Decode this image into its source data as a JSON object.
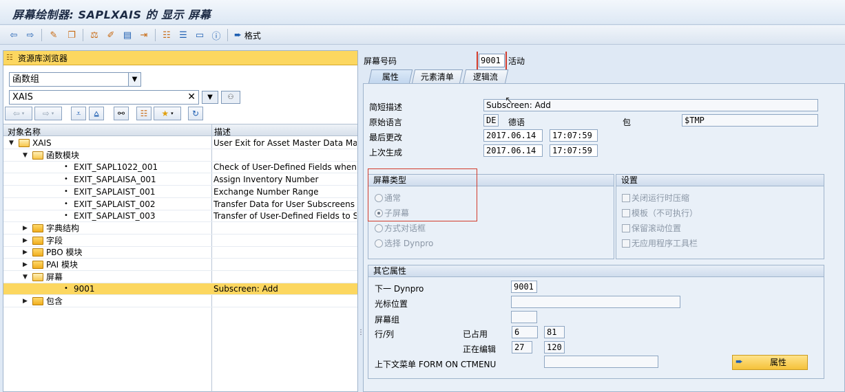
{
  "window": {
    "title": "屏幕绘制器: SAPLXAIS 的 显示 屏幕"
  },
  "toolbar": {
    "icons": [
      "back-icon",
      "forward-icon",
      "display-change-icon",
      "other-object-icon",
      "check-icon",
      "activate-icon",
      "test-icon",
      "where-used-icon",
      "hierarchy-icon",
      "layout-icon",
      "element-list-icon",
      "info-icon"
    ],
    "format_label": "格式"
  },
  "repository": {
    "header": "资源库浏览器",
    "object_type": "函数组",
    "object_name": "XAIS",
    "columns": {
      "name": "对象名称",
      "desc": "描述"
    },
    "rows": [
      {
        "name": "XAIS",
        "desc": "User Exit for Asset Master Data Maint.",
        "kind": "folder-open",
        "level": 0,
        "selected": false
      },
      {
        "name": "函数模块",
        "desc": "",
        "kind": "folder-open",
        "level": 1,
        "selected": false
      },
      {
        "name": "EXIT_SAPL1022_001",
        "desc": "Check of User-Defined Fields when Usi",
        "kind": "leaf",
        "level": 2,
        "selected": false
      },
      {
        "name": "EXIT_SAPLAISA_001",
        "desc": "Assign Inventory Number",
        "kind": "leaf",
        "level": 2,
        "selected": false
      },
      {
        "name": "EXIT_SAPLAIST_001",
        "desc": "Exchange Number Range",
        "kind": "leaf",
        "level": 2,
        "selected": false
      },
      {
        "name": "EXIT_SAPLAIST_002",
        "desc": "Transfer Data for User Subscreens",
        "kind": "leaf",
        "level": 2,
        "selected": false
      },
      {
        "name": "EXIT_SAPLAIST_003",
        "desc": "Transfer of User-Defined Fields to SAP",
        "kind": "leaf",
        "level": 2,
        "selected": false
      },
      {
        "name": "字典结构",
        "desc": "",
        "kind": "folder",
        "level": 1,
        "selected": false
      },
      {
        "name": "字段",
        "desc": "",
        "kind": "folder",
        "level": 1,
        "selected": false
      },
      {
        "name": "PBO 模块",
        "desc": "",
        "kind": "folder",
        "level": 1,
        "selected": false
      },
      {
        "name": "PAI 模块",
        "desc": "",
        "kind": "folder",
        "level": 1,
        "selected": false
      },
      {
        "name": "屏幕",
        "desc": "",
        "kind": "folder-open",
        "level": 1,
        "selected": false
      },
      {
        "name": "9001",
        "desc": "Subscreen: Add",
        "kind": "leaf",
        "level": 2,
        "selected": true
      },
      {
        "name": "包含",
        "desc": "",
        "kind": "folder",
        "level": 1,
        "selected": false
      }
    ]
  },
  "screen": {
    "number_label": "屏幕号码",
    "number": "9001",
    "status": "活动",
    "tabs": [
      "属性",
      "元素清单",
      "逻辑流"
    ],
    "active_tab": "属性"
  },
  "attributes": {
    "short_desc_label": "简短描述",
    "short_desc": "Subscreen: Add",
    "orig_lang_label": "原始语言",
    "orig_lang_code": "DE",
    "orig_lang_name": "德语",
    "package_label": "包",
    "package": "$TMP",
    "last_changed_label": "最后更改",
    "last_changed_date": "2017.06.14",
    "last_changed_time": "17:07:59",
    "last_generated_label": "上次生成",
    "last_generated_date": "2017.06.14",
    "last_generated_time": "17:07:59"
  },
  "screen_type": {
    "title": "屏幕类型",
    "options": [
      {
        "label": "通常",
        "checked": false
      },
      {
        "label": "子屏幕",
        "checked": true
      },
      {
        "label": "方式对话框",
        "checked": false
      },
      {
        "label": "选择 Dynpro",
        "checked": false
      }
    ]
  },
  "settings": {
    "title": "设置",
    "options": [
      "关闭运行时压缩",
      "模板（不可执行）",
      "保留滚动位置",
      "无应用程序工具栏"
    ]
  },
  "other": {
    "title": "其它属性",
    "next_dynpro_label": "下一 Dynpro",
    "next_dynpro": "9001",
    "cursor_pos_label": "光标位置",
    "cursor_pos": "",
    "screen_group_label": "屏幕组",
    "screen_group": "",
    "lines_cols_label": "行/列",
    "occupied_label": "已占用",
    "occupied_lines": "6",
    "occupied_cols": "81",
    "editing_label": "正在编辑",
    "editing_lines": "27",
    "editing_cols": "120",
    "context_menu_label": "上下文菜单 FORM ON CTMENU",
    "context_menu": "",
    "attr_button": "属性"
  }
}
